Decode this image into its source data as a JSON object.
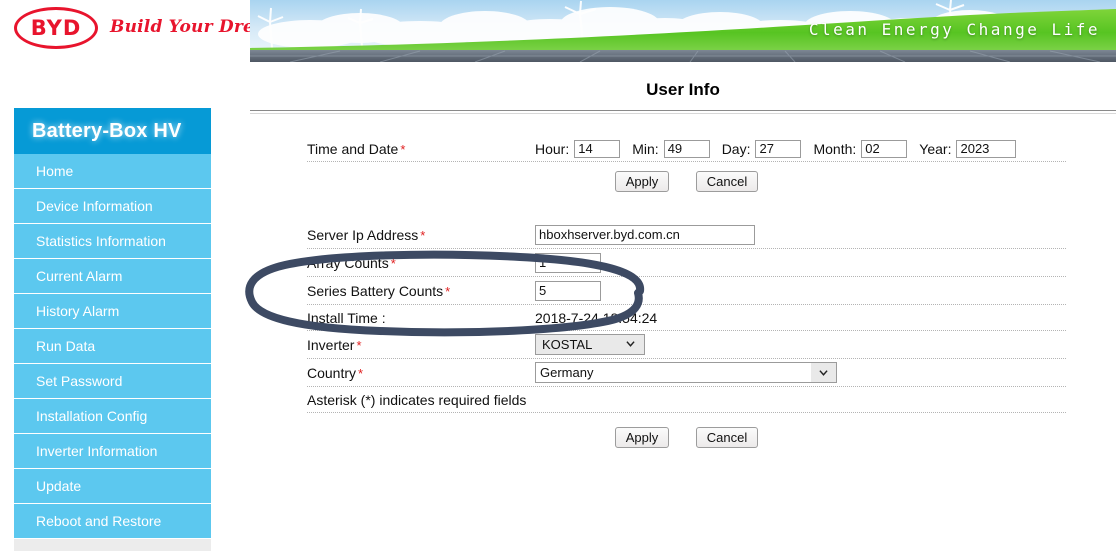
{
  "brand": {
    "logo_text": "BYD",
    "tagline": "Build Your Dreams",
    "banner_slogan": "Clean Energy Change Life"
  },
  "sidebar": {
    "title": "Battery-Box HV",
    "items": [
      {
        "label": "Home"
      },
      {
        "label": "Device Information"
      },
      {
        "label": "Statistics Information"
      },
      {
        "label": "Current Alarm"
      },
      {
        "label": "History Alarm"
      },
      {
        "label": "Run Data"
      },
      {
        "label": "Set Password"
      },
      {
        "label": "Installation Config"
      },
      {
        "label": "Inverter Information"
      },
      {
        "label": "Update"
      },
      {
        "label": "Reboot and Restore"
      }
    ]
  },
  "main": {
    "page_title": "User Info",
    "time_and_date": {
      "label": "Time and Date",
      "hour_label": "Hour:",
      "hour_value": "14",
      "min_label": "Min:",
      "min_value": "49",
      "day_label": "Day:",
      "day_value": "27",
      "month_label": "Month:",
      "month_value": "02",
      "year_label": "Year:",
      "year_value": "2023",
      "apply_label": "Apply",
      "cancel_label": "Cancel"
    },
    "server_ip": {
      "label": "Server Ip Address",
      "value": "hboxhserver.byd.com.cn"
    },
    "array_counts": {
      "label": "Array Counts",
      "value": "1"
    },
    "series_battery_counts": {
      "label": "Series Battery Counts",
      "value": "5"
    },
    "install_time": {
      "label": "Install Time :",
      "value": "2018-7-24 18:54:24"
    },
    "inverter": {
      "label": "Inverter",
      "selected": "KOSTAL"
    },
    "country": {
      "label": "Country",
      "selected": "Germany"
    },
    "required_note": "Asterisk (*) indicates required fields",
    "apply_label": "Apply",
    "cancel_label": "Cancel"
  },
  "colors": {
    "sidebar_header": "#069ad6",
    "sidebar_item": "#5cc8ef",
    "brand_red": "#e8142d",
    "required_star": "#e02020",
    "annotation": "#3d4a63"
  }
}
